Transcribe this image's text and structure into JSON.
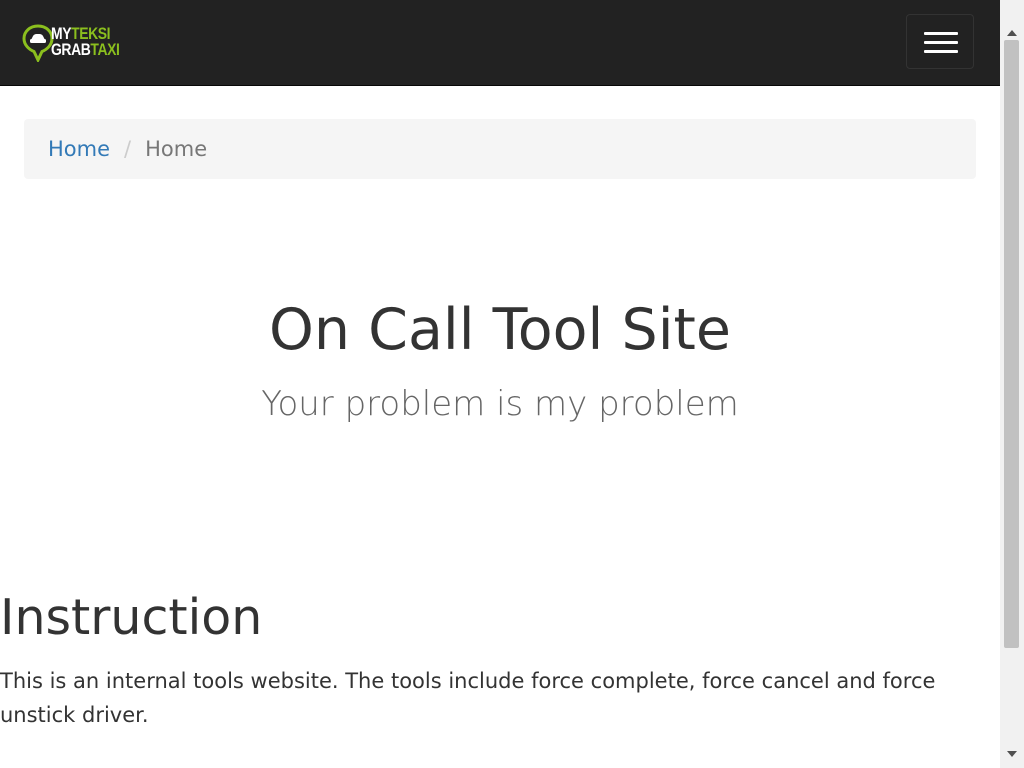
{
  "navbar": {
    "logo": {
      "line1": {
        "part1": "MY",
        "part2": "TEKSI"
      },
      "line2": {
        "part1": "GRAB",
        "part2": "TAXI"
      },
      "colors": {
        "white": "#ffffff",
        "green": "#8bbf1e"
      },
      "icon": "location-pin-car-icon"
    },
    "toggle_icon": "hamburger-menu-icon",
    "background": "#222222"
  },
  "breadcrumb": {
    "items": [
      {
        "label": "Home",
        "active": false
      },
      {
        "label": "Home",
        "active": true
      }
    ],
    "separator": "/",
    "link_color": "#337ab7"
  },
  "hero": {
    "title": "On Call Tool Site",
    "subtitle": "Your problem is my problem"
  },
  "section": {
    "heading": "Instruction",
    "text": "This is an internal tools website. The tools include force complete, force cancel and force unstick driver."
  }
}
